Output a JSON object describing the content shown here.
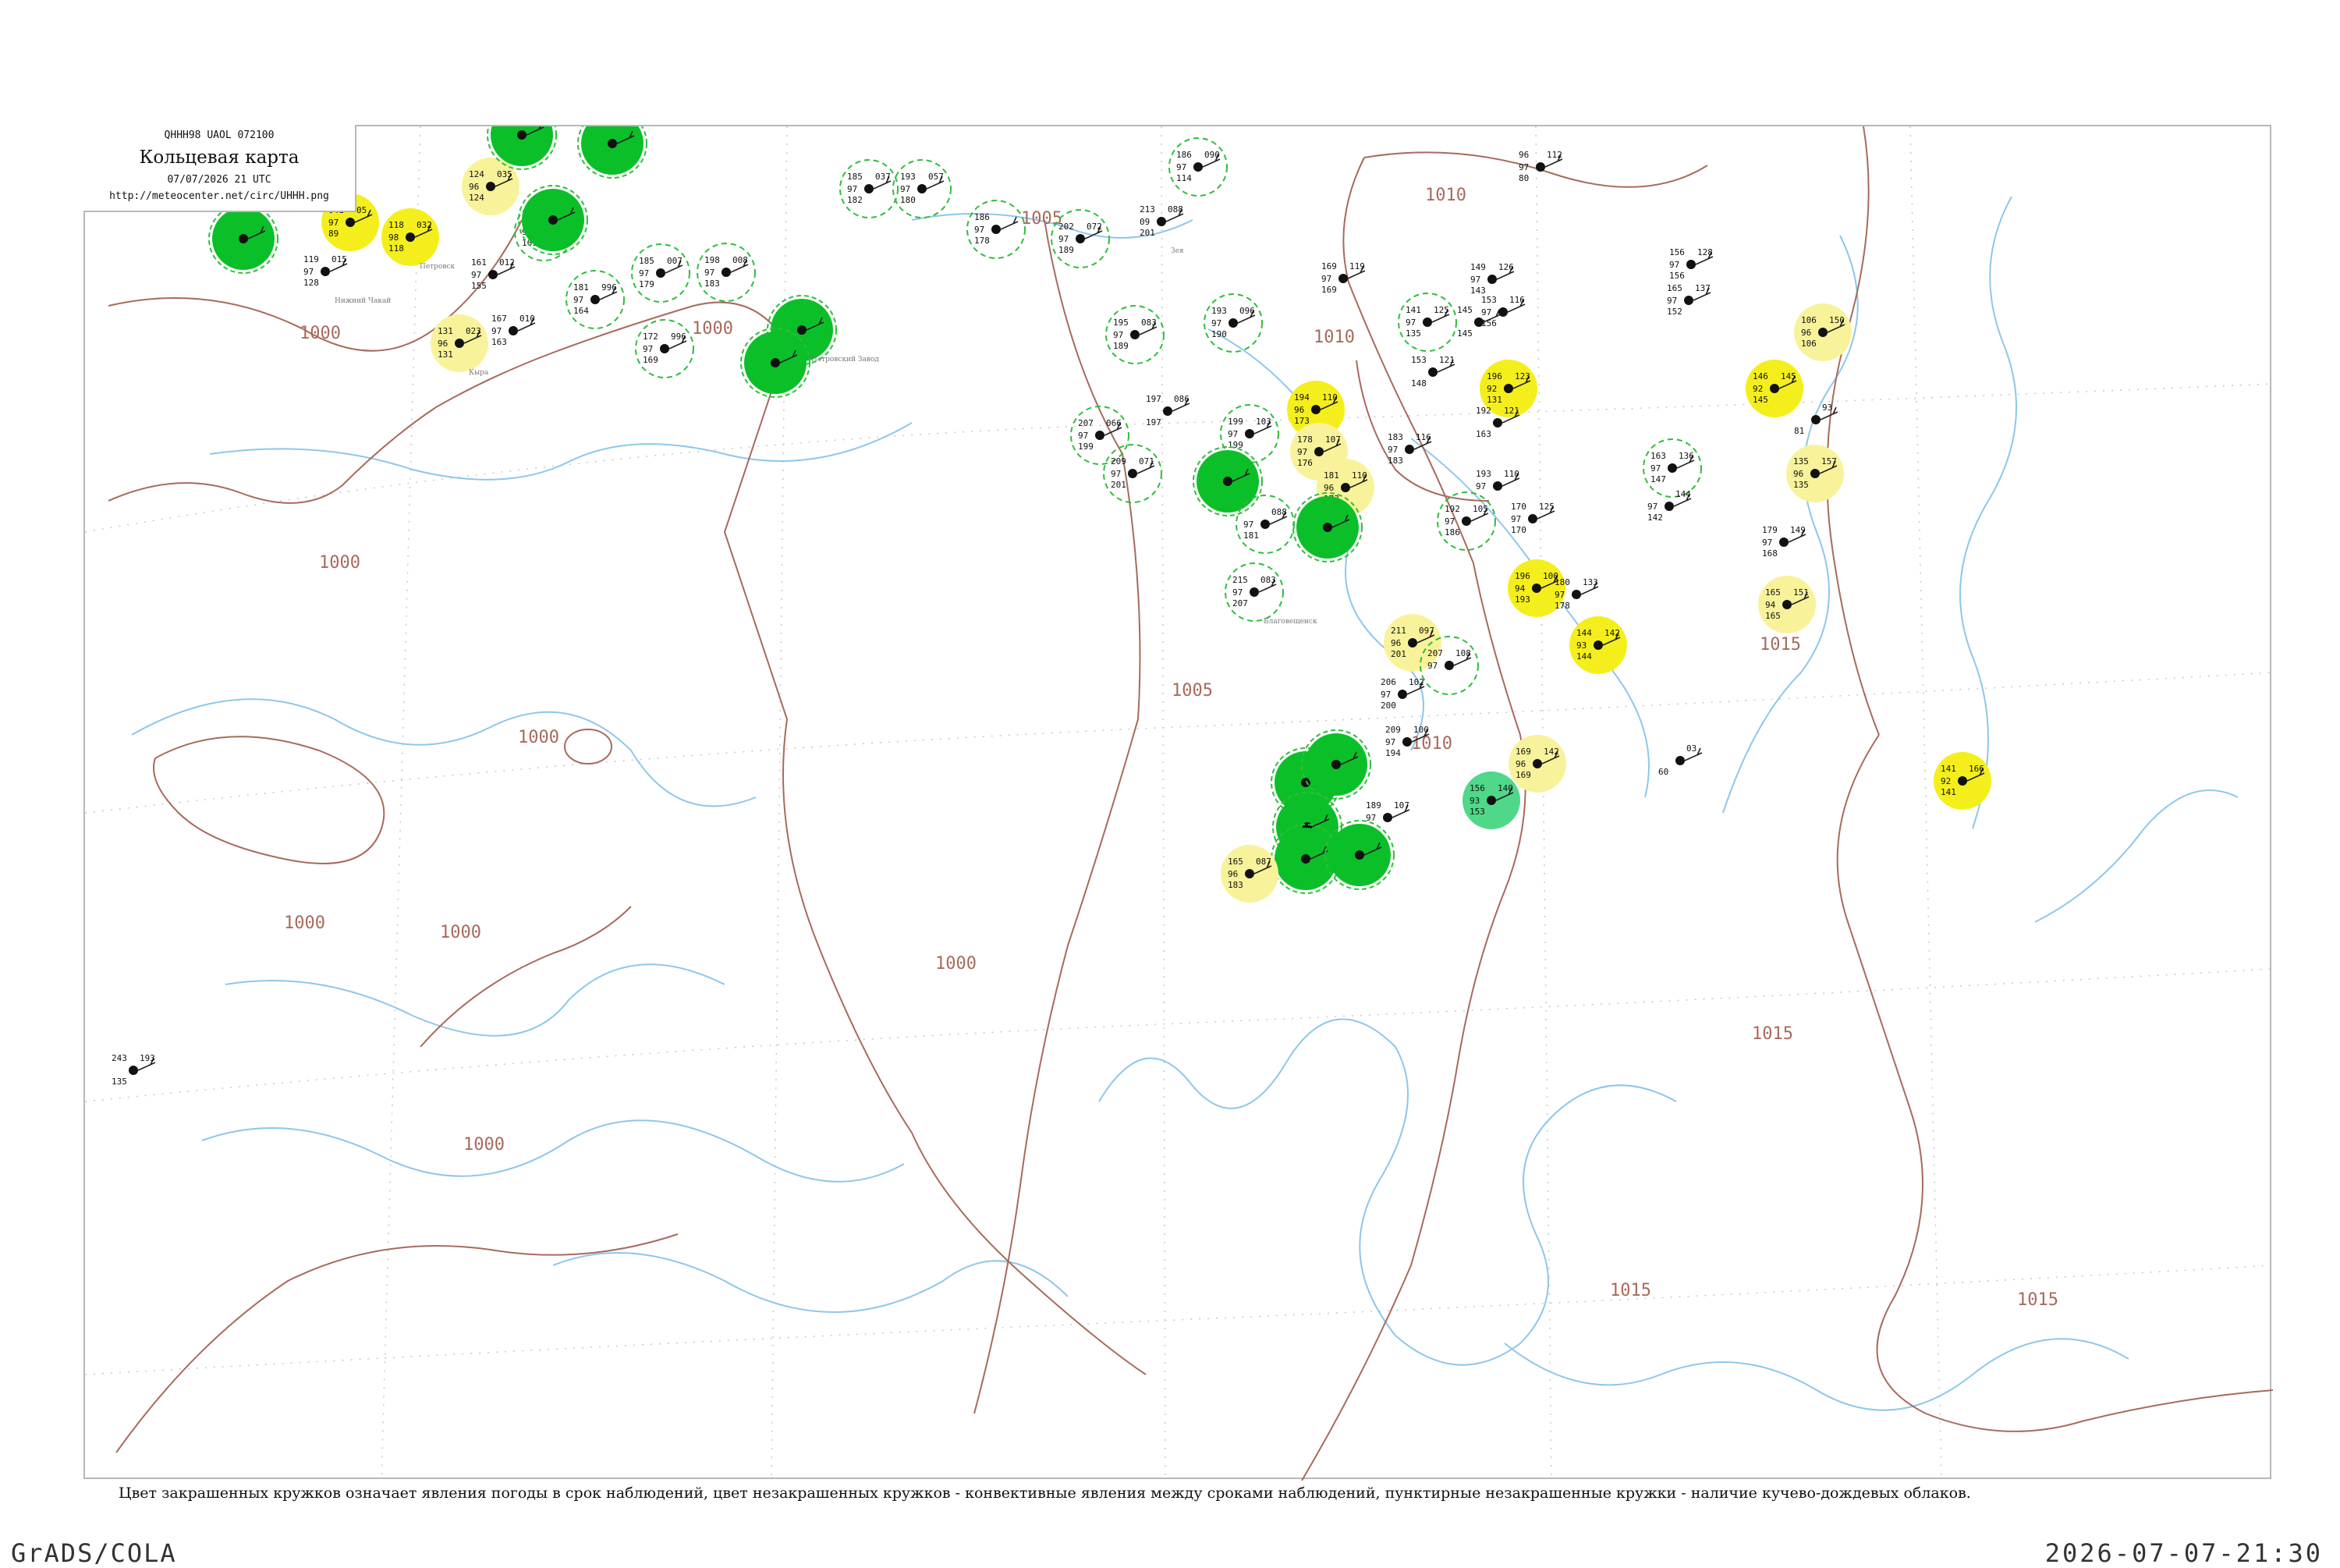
{
  "header": {
    "code_line": "QHHH98  UAOL  072100",
    "title": "Кольцевая карта",
    "datetime": "07/07/2026 21 UTC",
    "url": "http://meteocenter.net/circ/UHHH.png"
  },
  "legend_text": "Цвет закрашенных кружков означает явления погоды в срок наблюдений, цвет незакрашенных кружков - конвективные явления между сроками наблюдений, пунктирные незакрашенные кружки - наличие кучево-дождевых облаков.",
  "footer": {
    "left": "GrADS/COLA",
    "right": "2026-07-07-21:30"
  },
  "colors": {
    "isobar": "#a86a5c",
    "coast": "#8ec7ea",
    "green_fill": "#0bbf29",
    "yellow_fill": "#f4ef1c",
    "pale_yellow_fill": "#f8f39a",
    "mint_fill": "#4fd88a",
    "dashed_ring": "#2fbe3c",
    "text": "#111111",
    "name_text": "#7a7a7a"
  },
  "isobar_labels": [
    "1000",
    "1000",
    "1000",
    "1000",
    "1000",
    "1000",
    "1000",
    "1000",
    "1005",
    "1005",
    "1010",
    "1010",
    "1010",
    "1015",
    "1015",
    "1015",
    "1015"
  ],
  "stations": [
    {
      "a": "",
      "b": "",
      "c": "",
      "d": "",
      "name": "",
      "kind": "green"
    },
    {
      "a": "041",
      "b": "05",
      "c": "89",
      "d": "97",
      "name": "",
      "kind": "yellow"
    },
    {
      "a": "118",
      "b": "032",
      "c": "118",
      "d": "98",
      "name": "Петровск",
      "kind": "yellow"
    },
    {
      "a": "124",
      "b": "035",
      "c": "124",
      "d": "96",
      "name": "",
      "kind": "pale"
    },
    {
      "a": "",
      "b": "",
      "c": "",
      "d": "",
      "name": "",
      "kind": "green"
    },
    {
      "a": "163",
      "b": "009",
      "c": "161",
      "d": "97",
      "name": "",
      "kind": "dashed"
    },
    {
      "a": "",
      "b": "",
      "c": "",
      "d": "",
      "name": "",
      "kind": "green"
    },
    {
      "a": "",
      "b": "",
      "c": "",
      "d": "",
      "name": "",
      "kind": "green"
    },
    {
      "a": "119",
      "b": "015",
      "c": "128",
      "d": "97",
      "name": "Нижний Чакай",
      "kind": "plain"
    },
    {
      "a": "161",
      "b": "012",
      "c": "155",
      "d": "97",
      "name": "",
      "kind": "plain"
    },
    {
      "a": "185",
      "b": "007",
      "c": "179",
      "d": "97",
      "name": "",
      "kind": "dashed"
    },
    {
      "a": "198",
      "b": "008",
      "c": "183",
      "d": "97",
      "name": "",
      "kind": "dashed"
    },
    {
      "a": "181",
      "b": "996",
      "c": "164",
      "d": "97",
      "name": "",
      "kind": "dashed"
    },
    {
      "a": "167",
      "b": "010",
      "c": "163",
      "d": "97",
      "name": "",
      "kind": "plain"
    },
    {
      "a": "131",
      "b": "023",
      "c": "131",
      "d": "96",
      "name": "Кыра",
      "kind": "pale"
    },
    {
      "a": "172",
      "b": "996",
      "c": "169",
      "d": "97",
      "name": "",
      "kind": "dashed"
    },
    {
      "a": "",
      "b": "",
      "c": "",
      "d": "",
      "name": "Петровский Завод",
      "kind": "green"
    },
    {
      "a": "",
      "b": "",
      "c": "",
      "d": "",
      "name": "",
      "kind": "green"
    },
    {
      "a": "185",
      "b": "037",
      "c": "182",
      "d": "97",
      "name": "",
      "kind": "dashed"
    },
    {
      "a": "193",
      "b": "057",
      "c": "180",
      "d": "97",
      "name": "",
      "kind": "dashed"
    },
    {
      "a": "186",
      "b": "",
      "c": "178",
      "d": "97",
      "name": "",
      "kind": "dashed"
    },
    {
      "a": "202",
      "b": "072",
      "c": "189",
      "d": "97",
      "name": "",
      "kind": "dashed"
    },
    {
      "a": "213",
      "b": "088",
      "c": "201",
      "d": "09",
      "name": "Зея",
      "kind": "plain"
    },
    {
      "a": "186",
      "b": "090",
      "c": "114",
      "d": "97",
      "name": "",
      "kind": "dashed"
    },
    {
      "a": "195",
      "b": "083",
      "c": "189",
      "d": "97",
      "name": "",
      "kind": "dashed"
    },
    {
      "a": "193",
      "b": "096",
      "c": "190",
      "d": "97",
      "name": "",
      "kind": "dashed"
    },
    {
      "a": "197",
      "b": "086",
      "c": "197",
      "d": "",
      "name": "",
      "kind": "plain"
    },
    {
      "a": "207",
      "b": "066",
      "c": "199",
      "d": "97",
      "name": "",
      "kind": "dashed"
    },
    {
      "a": "209",
      "b": "071",
      "c": "201",
      "d": "97",
      "name": "",
      "kind": "dashed"
    },
    {
      "a": "199",
      "b": "103",
      "c": "199",
      "d": "97",
      "name": "",
      "kind": "dashed"
    },
    {
      "a": "194",
      "b": "110",
      "c": "173",
      "d": "96",
      "name": "",
      "kind": "yellow"
    },
    {
      "a": "178",
      "b": "107",
      "c": "176",
      "d": "97",
      "name": "",
      "kind": "pale"
    },
    {
      "a": "",
      "b": "",
      "c": "",
      "d": "",
      "name": "",
      "kind": "green"
    },
    {
      "a": "",
      "b": "088",
      "c": "181",
      "d": "97",
      "name": "",
      "kind": "dashed"
    },
    {
      "a": "181",
      "b": "110",
      "c": "173",
      "d": "96",
      "name": "",
      "kind": "pale"
    },
    {
      "a": "",
      "b": "",
      "c": "",
      "d": "",
      "name": "",
      "kind": "green"
    },
    {
      "a": "215",
      "b": "083",
      "c": "207",
      "d": "97",
      "name": "Благовещенск",
      "kind": "dashed"
    },
    {
      "a": "169",
      "b": "119",
      "c": "169",
      "d": "97",
      "name": "",
      "kind": "plain"
    },
    {
      "a": "141",
      "b": "125",
      "c": "135",
      "d": "97",
      "name": "",
      "kind": "dashed"
    },
    {
      "a": "145",
      "b": "",
      "c": "145",
      "d": "",
      "name": "",
      "kind": "plain"
    },
    {
      "a": "149",
      "b": "126",
      "c": "143",
      "d": "97",
      "name": "",
      "kind": "plain"
    },
    {
      "a": "153",
      "b": "116",
      "c": "156",
      "d": "97",
      "name": "",
      "kind": "plain"
    },
    {
      "a": "96",
      "b": "112",
      "c": "80",
      "d": "97",
      "name": "",
      "kind": "plain"
    },
    {
      "a": "153",
      "b": "121",
      "c": "148",
      "d": "",
      "name": "",
      "kind": "plain"
    },
    {
      "a": "196",
      "b": "123",
      "c": "131",
      "d": "92",
      "name": "",
      "kind": "yellow"
    },
    {
      "a": "192",
      "b": "121",
      "c": "163",
      "d": "",
      "name": "",
      "kind": "plain"
    },
    {
      "a": "183",
      "b": "116",
      "c": "183",
      "d": "97",
      "name": "",
      "kind": "plain"
    },
    {
      "a": "193",
      "b": "110",
      "c": "",
      "d": "97",
      "name": "",
      "kind": "plain"
    },
    {
      "a": "192",
      "b": "105",
      "c": "186",
      "d": "97",
      "name": "",
      "kind": "dashed"
    },
    {
      "a": "170",
      "b": "125",
      "c": "170",
      "d": "97",
      "name": "",
      "kind": "plain"
    },
    {
      "a": "196",
      "b": "100",
      "c": "193",
      "d": "94",
      "name": "",
      "kind": "yellow"
    },
    {
      "a": "180",
      "b": "133",
      "c": "178",
      "d": "97",
      "name": "",
      "kind": "plain"
    },
    {
      "a": "211",
      "b": "097",
      "c": "201",
      "d": "96",
      "name": "",
      "kind": "pale"
    },
    {
      "a": "207",
      "b": "108",
      "c": "",
      "d": "97",
      "name": "",
      "kind": "dashed"
    },
    {
      "a": "206",
      "b": "102",
      "c": "200",
      "d": "97",
      "name": "",
      "kind": "plain"
    },
    {
      "a": "209",
      "b": "100",
      "c": "194",
      "d": "97",
      "name": "",
      "kind": "plain"
    },
    {
      "a": "144",
      "b": "142",
      "c": "144",
      "d": "93",
      "name": "",
      "kind": "yellow"
    },
    {
      "a": "163",
      "b": "136",
      "c": "147",
      "d": "97",
      "name": "",
      "kind": "dashed"
    },
    {
      "a": "",
      "b": "144",
      "c": "142",
      "d": "97",
      "name": "",
      "kind": "plain"
    },
    {
      "a": "156",
      "b": "128",
      "c": "156",
      "d": "97",
      "name": "",
      "kind": "plain"
    },
    {
      "a": "165",
      "b": "137",
      "c": "152",
      "d": "97",
      "name": "",
      "kind": "plain"
    },
    {
      "a": "106",
      "b": "150",
      "c": "106",
      "d": "96",
      "name": "",
      "kind": "pale"
    },
    {
      "a": "146",
      "b": "145",
      "c": "145",
      "d": "92",
      "name": "",
      "kind": "yellow"
    },
    {
      "a": "",
      "b": "93",
      "c": "81",
      "d": "",
      "name": "",
      "kind": "plain"
    },
    {
      "a": "135",
      "b": "157",
      "c": "135",
      "d": "96",
      "name": "",
      "kind": "pale"
    },
    {
      "a": "179",
      "b": "149",
      "c": "168",
      "d": "97",
      "name": "",
      "kind": "plain"
    },
    {
      "a": "165",
      "b": "151",
      "c": "165",
      "d": "94",
      "name": "",
      "kind": "pale"
    },
    {
      "a": "169",
      "b": "142",
      "c": "169",
      "d": "96",
      "name": "",
      "kind": "pale"
    },
    {
      "a": "156",
      "b": "140",
      "c": "153",
      "d": "93",
      "name": "",
      "kind": "mint"
    },
    {
      "a": "",
      "b": "",
      "c": "",
      "d": "",
      "name": "",
      "kind": "green"
    },
    {
      "a": "",
      "b": "",
      "c": "",
      "d": "",
      "name": "",
      "kind": "green"
    },
    {
      "a": "",
      "b": "",
      "c": "",
      "d": "",
      "name": "",
      "kind": "green"
    },
    {
      "a": "189",
      "b": "107",
      "c": "",
      "d": "97",
      "name": "",
      "kind": "plain"
    },
    {
      "a": "",
      "b": "",
      "c": "",
      "d": "",
      "name": "",
      "kind": "green"
    },
    {
      "a": "",
      "b": "",
      "c": "",
      "d": "",
      "name": "",
      "kind": "green"
    },
    {
      "a": "165",
      "b": "087",
      "c": "183",
      "d": "96",
      "name": "",
      "kind": "pale"
    },
    {
      "a": "",
      "b": "03",
      "c": "60",
      "d": "",
      "name": "",
      "kind": "plain"
    },
    {
      "a": "141",
      "b": "166",
      "c": "141",
      "d": "92",
      "name": "",
      "kind": "yellow"
    },
    {
      "a": "243",
      "b": "193",
      "c": "135",
      "d": "",
      "name": "",
      "kind": "plain"
    }
  ]
}
